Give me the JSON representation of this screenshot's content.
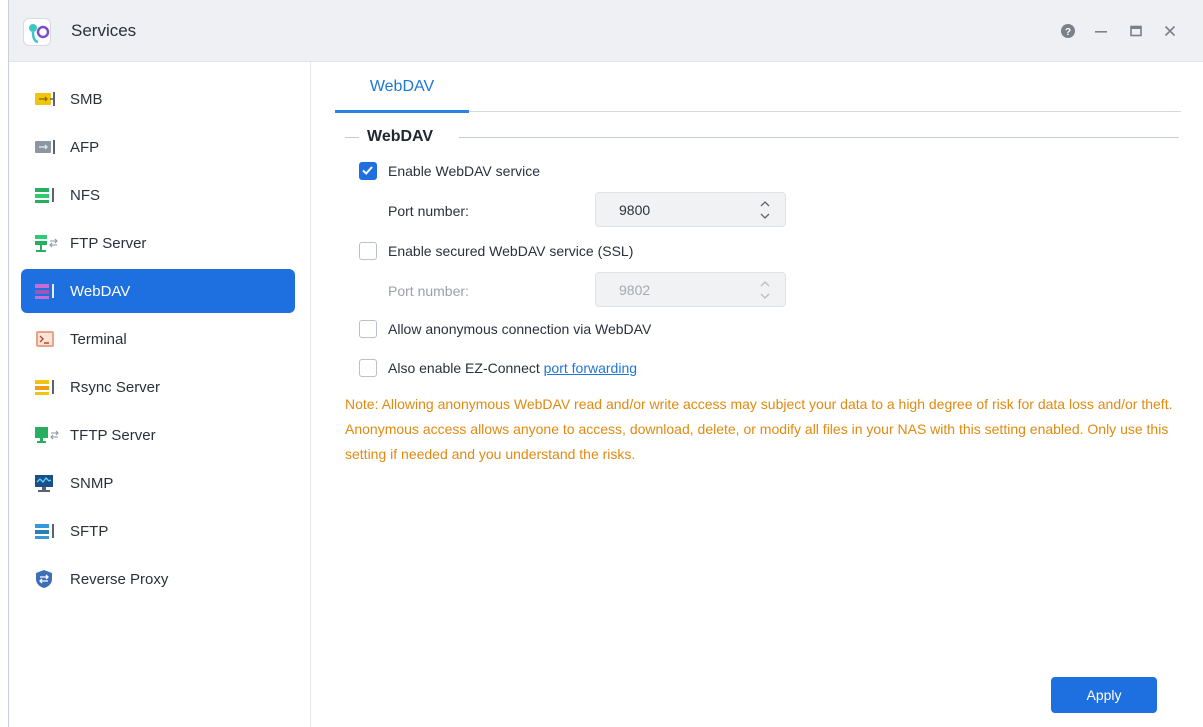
{
  "window": {
    "title": "Services"
  },
  "sidebar": {
    "items": [
      {
        "label": "SMB",
        "icon": "smb-icon",
        "active": false
      },
      {
        "label": "AFP",
        "icon": "afp-icon",
        "active": false
      },
      {
        "label": "NFS",
        "icon": "nfs-icon",
        "active": false
      },
      {
        "label": "FTP Server",
        "icon": "ftp-server-icon",
        "active": false
      },
      {
        "label": "WebDAV",
        "icon": "webdav-icon",
        "active": true
      },
      {
        "label": "Terminal",
        "icon": "terminal-icon",
        "active": false
      },
      {
        "label": "Rsync Server",
        "icon": "rsync-server-icon",
        "active": false
      },
      {
        "label": "TFTP Server",
        "icon": "tftp-server-icon",
        "active": false
      },
      {
        "label": "SNMP",
        "icon": "snmp-icon",
        "active": false
      },
      {
        "label": "SFTP",
        "icon": "sftp-icon",
        "active": false
      },
      {
        "label": "Reverse Proxy",
        "icon": "reverse-proxy-icon",
        "active": false
      }
    ]
  },
  "main": {
    "tabs": [
      {
        "label": "WebDAV",
        "active": true
      }
    ],
    "section_title": "WebDAV",
    "enable_webdav": {
      "label": "Enable WebDAV service",
      "checked": true
    },
    "port": {
      "label": "Port number:",
      "value": "9800"
    },
    "enable_ssl": {
      "label": "Enable secured WebDAV service (SSL)",
      "checked": false
    },
    "ssl_port": {
      "label": "Port number:",
      "value": "9802",
      "disabled": true
    },
    "anonymous": {
      "label": "Allow anonymous connection via WebDAV",
      "checked": false
    },
    "ez_connect": {
      "label": "Also enable EZ-Connect ",
      "link": "port forwarding",
      "checked": false
    },
    "note": "Note: Allowing anonymous WebDAV read and/or write access may subject your data to a high degree of risk for data loss and/or theft. Anonymous access allows anyone to access, download, delete, or modify all files in your NAS with this setting enabled. Only use this setting if needed and you understand the risks.",
    "apply_label": "Apply"
  },
  "colors": {
    "accent": "#1e6fe0",
    "note": "#e08a11",
    "link": "#1e77d6"
  }
}
